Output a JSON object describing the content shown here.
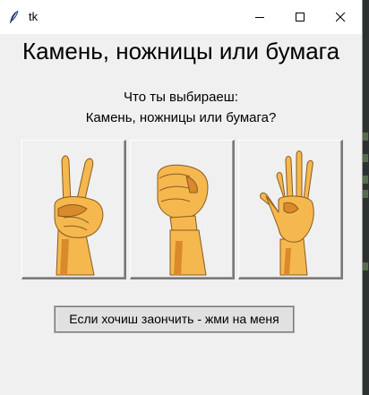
{
  "window": {
    "title": "tk"
  },
  "titlebar": {
    "minimize_icon": "minimize-icon",
    "maximize_icon": "maximize-icon",
    "close_icon": "close-icon"
  },
  "main": {
    "heading": "Камень, ножницы или бумага",
    "question_line1": "Что ты выбираеш:",
    "question_line2": "Камень, ножницы или бумага?",
    "choices": [
      {
        "name": "scissors",
        "icon": "hand-scissors-icon"
      },
      {
        "name": "rock",
        "icon": "hand-rock-icon"
      },
      {
        "name": "paper",
        "icon": "hand-paper-icon"
      }
    ],
    "quit_button": "Если хочиш заончить - жми на меня"
  },
  "colors": {
    "skin": "#f5b84f",
    "skin_shade": "#d98a2b",
    "outline": "#8a5a1c",
    "window_bg": "#f0f0f0"
  }
}
